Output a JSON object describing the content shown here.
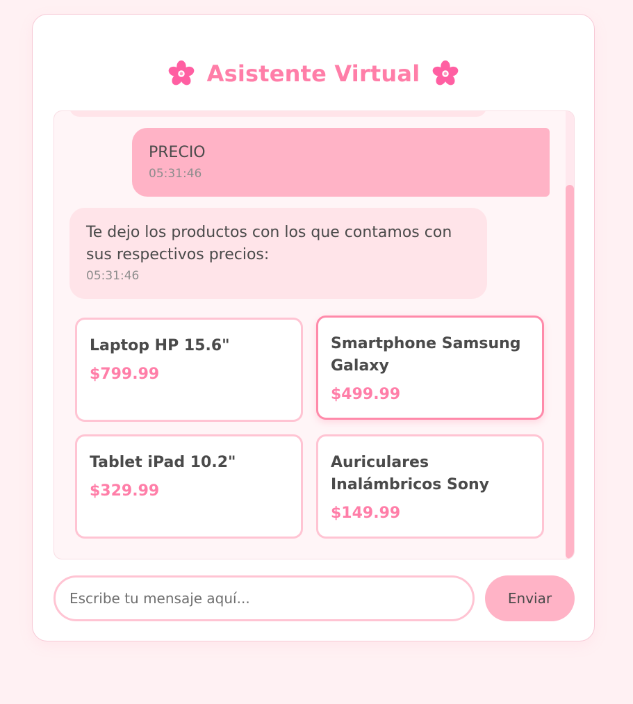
{
  "header": {
    "title": "Asistente Virtual",
    "left_icon": "cherry-blossom-icon",
    "right_icon": "cherry-blossom-icon"
  },
  "messages": [
    {
      "sender": "user",
      "text": "PRECIO",
      "time": "05:31:46"
    },
    {
      "sender": "bot",
      "text": "Te dejo los productos con los que contamos con sus respectivos precios:",
      "time": "05:31:46"
    }
  ],
  "products": [
    {
      "name": "Laptop HP 15.6\"",
      "price": "$799.99"
    },
    {
      "name": "Smartphone Samsung Galaxy",
      "price": "$499.99"
    },
    {
      "name": "Tablet iPad 10.2\"",
      "price": "$329.99"
    },
    {
      "name": "Auriculares Inalámbricos Sony",
      "price": "$149.99"
    }
  ],
  "input": {
    "placeholder": "Escribe tu mensaje aquí...",
    "value": ""
  },
  "send_button": {
    "label": "Enviar"
  },
  "colors": {
    "background": "#fff1f3",
    "accent": "#ff7ea8",
    "user_bubble": "#ffb3c6",
    "bot_bubble": "#ffe4e9",
    "border": "#ffc4d3"
  }
}
